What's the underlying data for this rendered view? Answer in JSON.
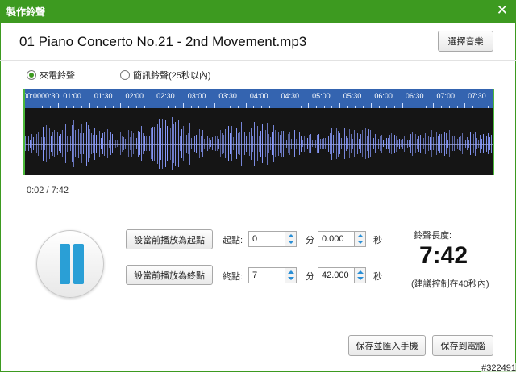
{
  "window": {
    "title": "製作鈴聲",
    "close_icon": "✕"
  },
  "file": {
    "name": "01 Piano Concerto No.21 - 2nd Movement.mp3",
    "select_label": "選擇音樂"
  },
  "ringtone_type": [
    {
      "label": "來電鈴聲",
      "selected": true
    },
    {
      "label": "簡訊鈴聲(25秒以內)",
      "selected": false
    }
  ],
  "timeline": {
    "ticks": [
      "00:0000:30",
      "01:00",
      "01:30",
      "02:00",
      "02:30",
      "03:00",
      "03:30",
      "04:00",
      "04:30",
      "05:00",
      "05:30",
      "06:00",
      "06:30",
      "07:00",
      "07:30"
    ]
  },
  "playback": {
    "position": "0:02 / 7:42",
    "state": "paused"
  },
  "controls": {
    "set_start_label": "設當前播放為起點",
    "set_end_label": "設當前播放為終點",
    "start_label": "起點:",
    "end_label": "終點:",
    "min_unit": "分",
    "sec_unit": "秒",
    "start_min": "0",
    "start_sec": "0.000",
    "end_min": "7",
    "end_sec": "42.000"
  },
  "length": {
    "label": "鈴聲長度:",
    "value": "7:42",
    "hint": "(建議控制在40秒內)"
  },
  "buttons": {
    "save_import": "保存並匯入手機",
    "save_pc": "保存到電腦"
  },
  "watermark": "#322491",
  "colors": {
    "titlebar": "#3d9a20",
    "timeline": "#3464b0",
    "wave_bg": "#151515",
    "wave": "#8a9cff",
    "accent": "#2a9fd6"
  }
}
